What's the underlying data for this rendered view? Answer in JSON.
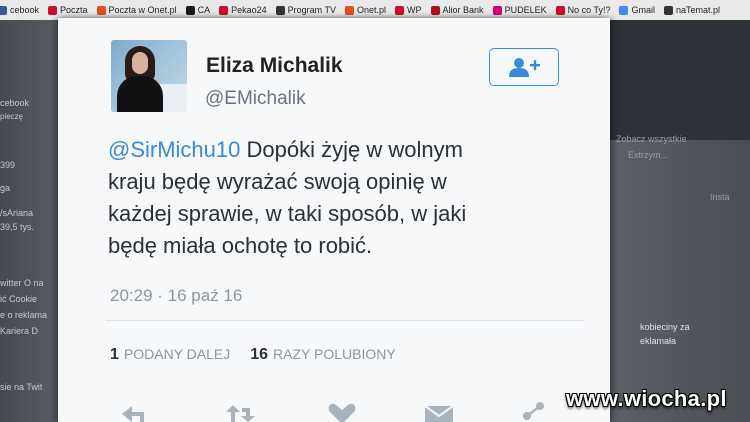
{
  "bookmarks": [
    {
      "label": "cebook",
      "color": "#3b5998"
    },
    {
      "label": "Poczta",
      "color": "#c8102e"
    },
    {
      "label": "Poczta w Onet.pl",
      "color": "#e2501f"
    },
    {
      "label": "CA",
      "color": "#1a1a1a"
    },
    {
      "label": "Pekao24",
      "color": "#c8102e"
    },
    {
      "label": "Program TV",
      "color": "#333333"
    },
    {
      "label": "Onet.pl",
      "color": "#e2501f"
    },
    {
      "label": "WP",
      "color": "#c8102e"
    },
    {
      "label": "Alior Bank",
      "color": "#b5121b"
    },
    {
      "label": "PUDELEK",
      "color": "#d6006f"
    },
    {
      "label": "No co Ty!?",
      "color": "#c8102e"
    },
    {
      "label": "Gmail",
      "color": "#4285f4"
    },
    {
      "label": "naTemat.pl",
      "color": "#333333"
    }
  ],
  "background_left": [
    "cebook",
    "pieczę",
    "399",
    "ga",
    "/sAriana",
    "39,5 tys.",
    "witter  O na",
    "ić  Cookie",
    "e o reklama",
    "Kariera  D",
    "sie na Twit"
  ],
  "background_right": [
    "Zobacz wszystkie",
    "Extrzym...",
    "Insta",
    "kobieciny za",
    "eklamała"
  ],
  "tweet": {
    "name": "Eliza Michalik",
    "handle": "@EMichalik",
    "mention": "@SirMichu10",
    "text_lines": [
      " Dopóki żyję w wolnym",
      "kraju będę wyrażać swoją opinię w",
      "każdej sprawie,  w taki sposób, w jaki",
      "będę miała ochotę to robić."
    ],
    "timestamp": "20:29 · 16 paź 16",
    "retweets_count": "1",
    "retweets_label": "PODANY DALEJ",
    "likes_count": "16",
    "likes_label": "RAZY POLUBIONY",
    "accent_color": "#3b8ad9"
  },
  "watermark": "www.wiocha.pl"
}
